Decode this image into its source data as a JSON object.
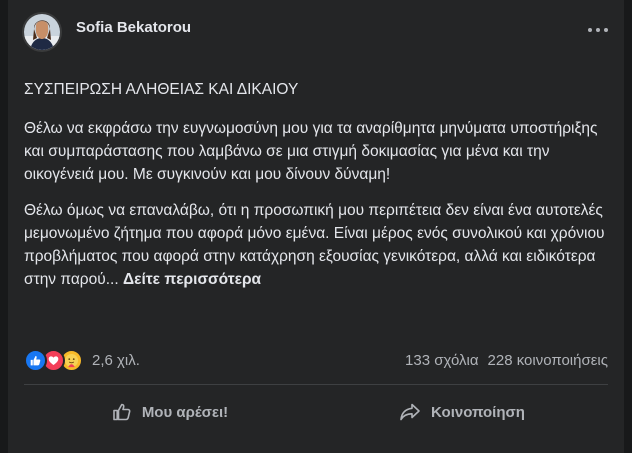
{
  "post": {
    "author": "Sofia Bekatorou",
    "heading": "ΣΥΣΠΕΙΡΩΣΗ ΑΛΗΘΕΙΑΣ ΚΑΙ ΔΙΚΑΙΟΥ",
    "paragraph1": "Θέλω να εκφράσω την ευγνωμοσύνη μου για τα αναρίθμητα μηνύματα υποστήριξης και συμπαράστασης που λαμβάνω σε μια στιγμή δοκιμασίας για μένα και την οικογένειά μου.  Με συγκινούν και μου δίνουν δύναμη!",
    "paragraph2": "Θέλω όμως να επαναλάβω, ότι η προσωπική μου περιπέτεια δεν είναι ένα αυτοτελές μεμονωμένο ζήτημα που αφορά μόνο εμένα. Είναι μέρος ενός συνολικού και χρόνιου προβλήματος που αφορά στην κατάχρηση εξουσίας γενικότερα, αλλά και ειδικότερα στην παρού...",
    "see_more": "Δείτε περισσότερα"
  },
  "stats": {
    "reaction_icons": [
      "like-icon",
      "love-icon",
      "care-icon"
    ],
    "reactions": "2,6 χιλ.",
    "comments": "133 σχόλια",
    "shares": "228 κοινοποιήσεις"
  },
  "actions": {
    "like": "Μου αρέσει!",
    "share": "Κοινοποίηση"
  },
  "colors": {
    "background": "#242526",
    "text": "#e4e6eb",
    "secondary_text": "#b0b3b8",
    "like": "#1877f2",
    "love": "#f33e58",
    "care": "#f7b928"
  }
}
